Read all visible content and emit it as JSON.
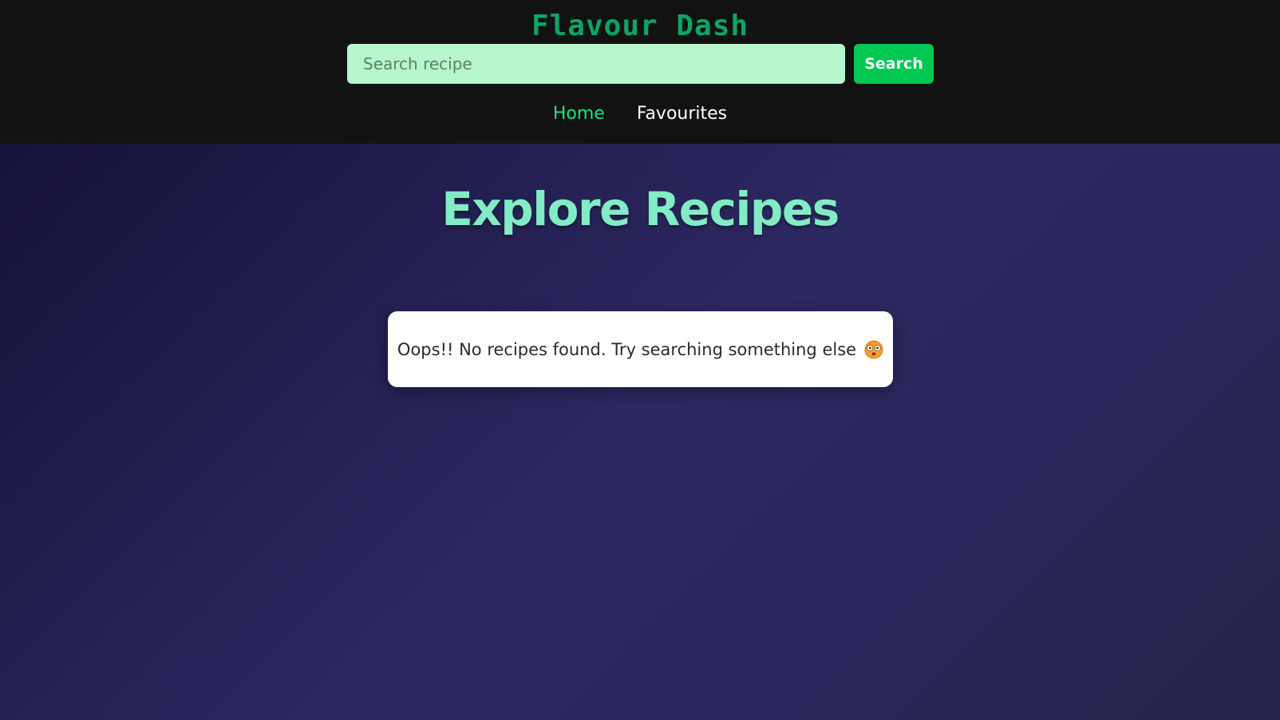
{
  "header": {
    "brand_title": "Flavour Dash",
    "search": {
      "placeholder": "Search recipe",
      "value": ""
    },
    "search_button_label": "Search",
    "nav": {
      "items": [
        {
          "label": "Home",
          "active": true
        },
        {
          "label": "Favourites",
          "active": false
        }
      ]
    }
  },
  "main": {
    "title": "Explore Recipes",
    "empty_state": {
      "message": "Oops!! No recipes found. Try searching something else",
      "icon": "flushed-face-icon"
    }
  },
  "colors": {
    "header_background": "#121212",
    "brand_text": "#0fa463",
    "search_field_background": "#b7f5cc",
    "search_button_background": "#00c853",
    "nav_active": "#1ee07c",
    "nav_inactive": "#ffffff",
    "title_text": "#82ecc6",
    "main_background_start": "#15123a",
    "main_background_end": "#2c2860",
    "card_background": "#ffffff"
  }
}
